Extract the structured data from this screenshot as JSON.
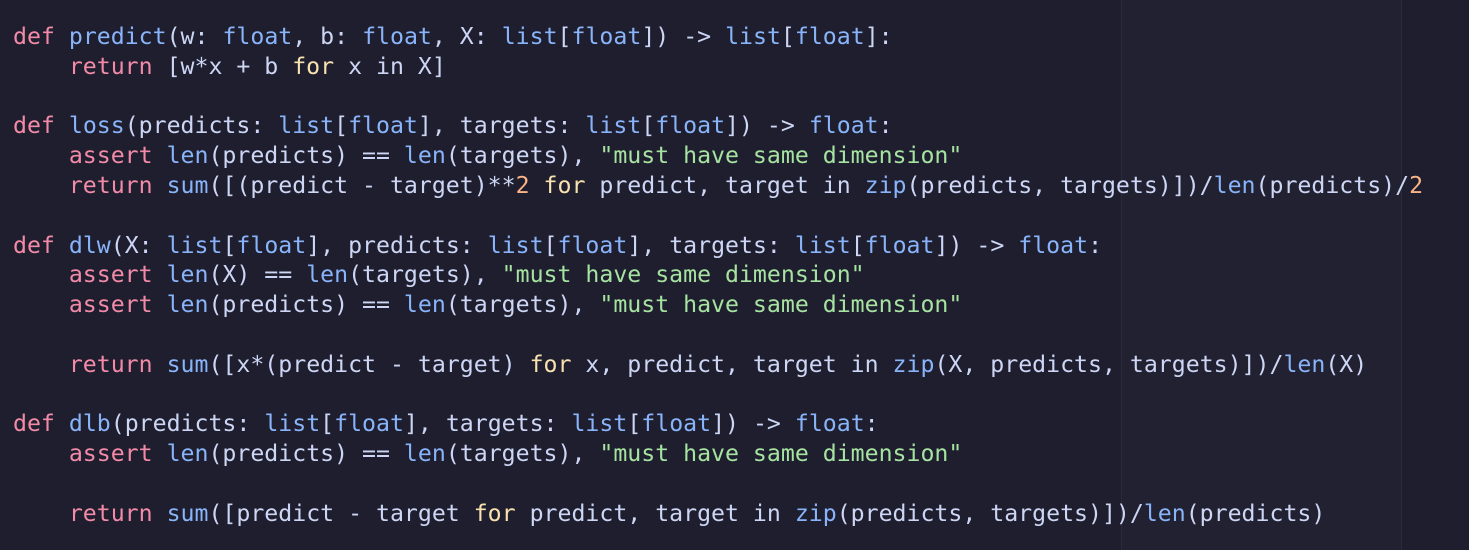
{
  "editor": {
    "colors": {
      "background": "#1e1e2e",
      "keyword": "#f38ba8",
      "function": "#89b4fa",
      "type": "#89b4fa",
      "builtin": "#89b4fa",
      "control": "#f9e2af",
      "number": "#fab387",
      "string": "#a6e3a1",
      "text": "#cdd6f4"
    },
    "lines": [
      [
        {
          "t": "kw",
          "v": "def"
        },
        {
          "t": "id",
          "v": " "
        },
        {
          "t": "fn",
          "v": "predict"
        },
        {
          "t": "id",
          "v": "(w: "
        },
        {
          "t": "ty",
          "v": "float"
        },
        {
          "t": "id",
          "v": ", b: "
        },
        {
          "t": "ty",
          "v": "float"
        },
        {
          "t": "id",
          "v": ", X: "
        },
        {
          "t": "ty",
          "v": "list"
        },
        {
          "t": "id",
          "v": "["
        },
        {
          "t": "ty",
          "v": "float"
        },
        {
          "t": "id",
          "v": "]) -> "
        },
        {
          "t": "ty",
          "v": "list"
        },
        {
          "t": "id",
          "v": "["
        },
        {
          "t": "ty",
          "v": "float"
        },
        {
          "t": "id",
          "v": "]:"
        }
      ],
      [
        {
          "t": "id",
          "v": "    "
        },
        {
          "t": "kw",
          "v": "return"
        },
        {
          "t": "id",
          "v": " [w*x + b "
        },
        {
          "t": "ctl",
          "v": "for"
        },
        {
          "t": "id",
          "v": " x in X]"
        }
      ],
      [],
      [
        {
          "t": "kw",
          "v": "def"
        },
        {
          "t": "id",
          "v": " "
        },
        {
          "t": "fn",
          "v": "loss"
        },
        {
          "t": "id",
          "v": "(predicts: "
        },
        {
          "t": "ty",
          "v": "list"
        },
        {
          "t": "id",
          "v": "["
        },
        {
          "t": "ty",
          "v": "float"
        },
        {
          "t": "id",
          "v": "], targets: "
        },
        {
          "t": "ty",
          "v": "list"
        },
        {
          "t": "id",
          "v": "["
        },
        {
          "t": "ty",
          "v": "float"
        },
        {
          "t": "id",
          "v": "]) -> "
        },
        {
          "t": "ty",
          "v": "float"
        },
        {
          "t": "id",
          "v": ":"
        }
      ],
      [
        {
          "t": "id",
          "v": "    "
        },
        {
          "t": "kw",
          "v": "assert"
        },
        {
          "t": "id",
          "v": " "
        },
        {
          "t": "bi",
          "v": "len"
        },
        {
          "t": "id",
          "v": "(predicts) == "
        },
        {
          "t": "bi",
          "v": "len"
        },
        {
          "t": "id",
          "v": "(targets), "
        },
        {
          "t": "str",
          "v": "\"must have same dimension\""
        }
      ],
      [
        {
          "t": "id",
          "v": "    "
        },
        {
          "t": "kw",
          "v": "return"
        },
        {
          "t": "id",
          "v": " "
        },
        {
          "t": "bi",
          "v": "sum"
        },
        {
          "t": "id",
          "v": "([(predict - target)**"
        },
        {
          "t": "num",
          "v": "2"
        },
        {
          "t": "id",
          "v": " "
        },
        {
          "t": "ctl",
          "v": "for"
        },
        {
          "t": "id",
          "v": " predict, target in "
        },
        {
          "t": "bi",
          "v": "zip"
        },
        {
          "t": "id",
          "v": "(predicts, targets)])/"
        },
        {
          "t": "bi",
          "v": "len"
        },
        {
          "t": "id",
          "v": "(predicts)/"
        },
        {
          "t": "num",
          "v": "2"
        }
      ],
      [],
      [
        {
          "t": "kw",
          "v": "def"
        },
        {
          "t": "id",
          "v": " "
        },
        {
          "t": "fn",
          "v": "dlw"
        },
        {
          "t": "id",
          "v": "(X: "
        },
        {
          "t": "ty",
          "v": "list"
        },
        {
          "t": "id",
          "v": "["
        },
        {
          "t": "ty",
          "v": "float"
        },
        {
          "t": "id",
          "v": "], predicts: "
        },
        {
          "t": "ty",
          "v": "list"
        },
        {
          "t": "id",
          "v": "["
        },
        {
          "t": "ty",
          "v": "float"
        },
        {
          "t": "id",
          "v": "], targets: "
        },
        {
          "t": "ty",
          "v": "list"
        },
        {
          "t": "id",
          "v": "["
        },
        {
          "t": "ty",
          "v": "float"
        },
        {
          "t": "id",
          "v": "]) -> "
        },
        {
          "t": "ty",
          "v": "float"
        },
        {
          "t": "id",
          "v": ":"
        }
      ],
      [
        {
          "t": "id",
          "v": "    "
        },
        {
          "t": "kw",
          "v": "assert"
        },
        {
          "t": "id",
          "v": " "
        },
        {
          "t": "bi",
          "v": "len"
        },
        {
          "t": "id",
          "v": "(X) == "
        },
        {
          "t": "bi",
          "v": "len"
        },
        {
          "t": "id",
          "v": "(targets), "
        },
        {
          "t": "str",
          "v": "\"must have same dimension\""
        }
      ],
      [
        {
          "t": "id",
          "v": "    "
        },
        {
          "t": "kw",
          "v": "assert"
        },
        {
          "t": "id",
          "v": " "
        },
        {
          "t": "bi",
          "v": "len"
        },
        {
          "t": "id",
          "v": "(predicts) == "
        },
        {
          "t": "bi",
          "v": "len"
        },
        {
          "t": "id",
          "v": "(targets), "
        },
        {
          "t": "str",
          "v": "\"must have same dimension\""
        }
      ],
      [],
      [
        {
          "t": "id",
          "v": "    "
        },
        {
          "t": "kw",
          "v": "return"
        },
        {
          "t": "id",
          "v": " "
        },
        {
          "t": "bi",
          "v": "sum"
        },
        {
          "t": "id",
          "v": "([x*(predict - target) "
        },
        {
          "t": "ctl",
          "v": "for"
        },
        {
          "t": "id",
          "v": " x, predict, target in "
        },
        {
          "t": "bi",
          "v": "zip"
        },
        {
          "t": "id",
          "v": "(X, predicts, targets)])/"
        },
        {
          "t": "bi",
          "v": "len"
        },
        {
          "t": "id",
          "v": "(X)"
        }
      ],
      [],
      [
        {
          "t": "kw",
          "v": "def"
        },
        {
          "t": "id",
          "v": " "
        },
        {
          "t": "fn",
          "v": "dlb"
        },
        {
          "t": "id",
          "v": "(predicts: "
        },
        {
          "t": "ty",
          "v": "list"
        },
        {
          "t": "id",
          "v": "["
        },
        {
          "t": "ty",
          "v": "float"
        },
        {
          "t": "id",
          "v": "], targets: "
        },
        {
          "t": "ty",
          "v": "list"
        },
        {
          "t": "id",
          "v": "["
        },
        {
          "t": "ty",
          "v": "float"
        },
        {
          "t": "id",
          "v": "]) -> "
        },
        {
          "t": "ty",
          "v": "float"
        },
        {
          "t": "id",
          "v": ":"
        }
      ],
      [
        {
          "t": "id",
          "v": "    "
        },
        {
          "t": "kw",
          "v": "assert"
        },
        {
          "t": "id",
          "v": " "
        },
        {
          "t": "bi",
          "v": "len"
        },
        {
          "t": "id",
          "v": "(predicts) == "
        },
        {
          "t": "bi",
          "v": "len"
        },
        {
          "t": "id",
          "v": "(targets), "
        },
        {
          "t": "str",
          "v": "\"must have same dimension\""
        }
      ],
      [],
      [
        {
          "t": "id",
          "v": "    "
        },
        {
          "t": "kw",
          "v": "return"
        },
        {
          "t": "id",
          "v": " "
        },
        {
          "t": "bi",
          "v": "sum"
        },
        {
          "t": "id",
          "v": "([predict - target "
        },
        {
          "t": "ctl",
          "v": "for"
        },
        {
          "t": "id",
          "v": " predict, target in "
        },
        {
          "t": "bi",
          "v": "zip"
        },
        {
          "t": "id",
          "v": "(predicts, targets)])/"
        },
        {
          "t": "bi",
          "v": "len"
        },
        {
          "t": "id",
          "v": "(predicts)"
        }
      ]
    ]
  }
}
